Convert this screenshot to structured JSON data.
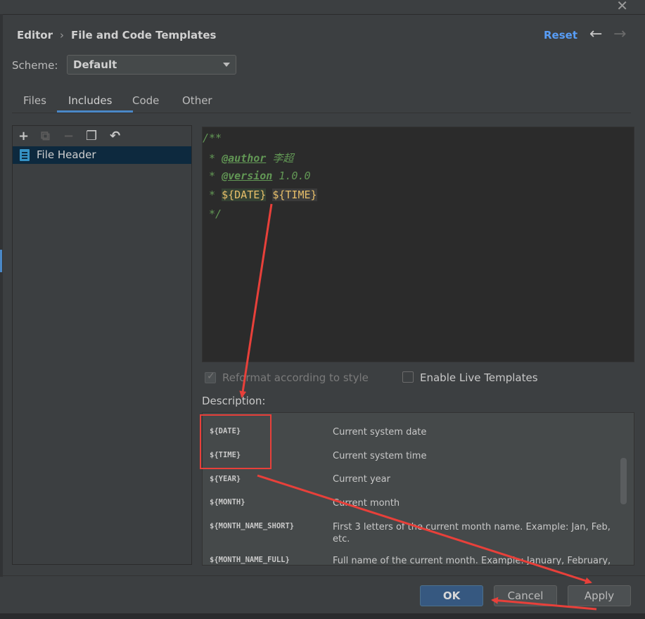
{
  "header": {
    "breadcrumb_root": "Editor",
    "breadcrumb_sep": "›",
    "breadcrumb_page": "File and Code Templates",
    "reset_label": "Reset",
    "back_icon": "←",
    "forward_icon": "→",
    "close_icon": "✕"
  },
  "scheme": {
    "label": "Scheme:",
    "value": "Default"
  },
  "tabs": [
    {
      "label": "Files"
    },
    {
      "label": "Includes",
      "selected": true
    },
    {
      "label": "Code"
    },
    {
      "label": "Other"
    }
  ],
  "toolbar": {
    "add": "+",
    "copy_disabled": "⧉",
    "remove": "−",
    "duplicate": "❐",
    "revert": "↶"
  },
  "tree": {
    "items": [
      {
        "label": "File Header"
      }
    ]
  },
  "editor": {
    "l1": "/**",
    "l2_prefix": " * ",
    "l2_tag": "@author",
    "l2_value": "李超",
    "l3_prefix": " * ",
    "l3_tag": "@version",
    "l3_value": "1.0.0",
    "l4_prefix": " * ",
    "l4_var1": "${DATE}",
    "l4_var2": "${TIME}",
    "l5": " */"
  },
  "options": {
    "reformat": "Reformat according to style",
    "reformat_checked": true,
    "live_templates": "Enable Live Templates",
    "live_templates_checked": false
  },
  "description": {
    "label": "Description:",
    "rows": [
      {
        "name": "${DATE}",
        "desc": "Current system date"
      },
      {
        "name": "${TIME}",
        "desc": "Current system time"
      },
      {
        "name": "${YEAR}",
        "desc": "Current year"
      },
      {
        "name": "${MONTH}",
        "desc": "Current month"
      },
      {
        "name": "${MONTH_NAME_SHORT}",
        "desc": "First 3 letters of the current month name. Example: Jan, Feb, etc."
      },
      {
        "name": "${MONTH_NAME_FULL}",
        "desc": "Full name of the current month. Example: January, February,"
      }
    ]
  },
  "buttons": {
    "ok": "OK",
    "cancel": "Cancel",
    "apply": "Apply"
  },
  "colors": {
    "annotation": "#e8403a",
    "accent": "#4a88c7",
    "primary_button": "#365880"
  }
}
